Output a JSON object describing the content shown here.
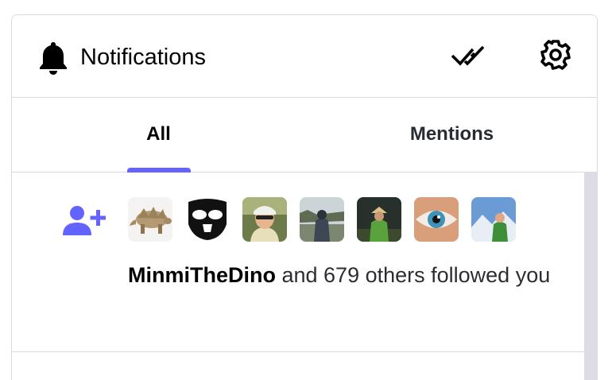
{
  "header": {
    "title": "Notifications",
    "icons": {
      "bell": "bell-icon",
      "mark_read": "double-check-icon",
      "settings": "gear-icon"
    }
  },
  "tabs": [
    {
      "label": "All",
      "active": true
    },
    {
      "label": "Mentions",
      "active": false
    }
  ],
  "colors": {
    "accent": "#6364ff",
    "border": "#d9d9e3",
    "scrollbar": "#dcdbe6"
  },
  "notifications": [
    {
      "type": "follow",
      "icon": "person-add-icon",
      "account": "MinmiTheDino",
      "rest_text": " and 679 others followed you",
      "avatars": [
        "dinosaur",
        "bearded-mask",
        "cyclist",
        "hiker-road",
        "hiker-dark",
        "eye",
        "mountain-climber"
      ]
    }
  ]
}
